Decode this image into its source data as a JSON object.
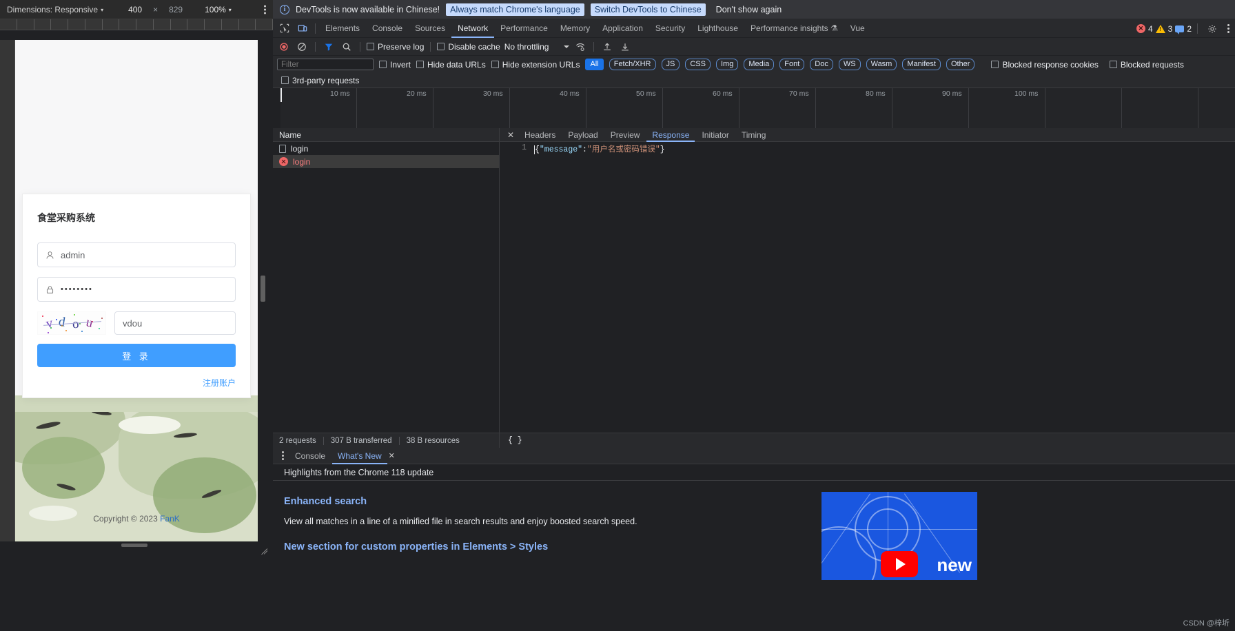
{
  "device_toolbar": {
    "dimensions_label": "Dimensions: Responsive",
    "caret": "▾",
    "width": "400",
    "times": "×",
    "height": "829",
    "zoom": "100%",
    "zoom_caret": "▾"
  },
  "login_page": {
    "title": "食堂采购系统",
    "username": {
      "icon": "user-icon",
      "value": "admin"
    },
    "password": {
      "icon": "lock-icon",
      "value": "••••••••"
    },
    "captcha": {
      "image_text": "vdou",
      "input_value": "vdou"
    },
    "submit_label": "登 录",
    "register_label": "注册账户",
    "copyright_prefix": "Copyright © 2023 ",
    "copyright_brand": "FanK"
  },
  "notification": {
    "icon": "info-icon",
    "message": "DevTools is now available in Chinese!",
    "primary_btn": "Always match Chrome's language",
    "secondary_btn": "Switch DevTools to Chinese",
    "dismiss_btn": "Don't show again"
  },
  "devtools_tabs": {
    "inspect_icon": "inspect-element-icon",
    "device_icon": "device-toolbar-icon",
    "items": [
      {
        "label": "Elements",
        "active": false
      },
      {
        "label": "Console",
        "active": false
      },
      {
        "label": "Sources",
        "active": false
      },
      {
        "label": "Network",
        "active": true
      },
      {
        "label": "Performance",
        "active": false
      },
      {
        "label": "Memory",
        "active": false
      },
      {
        "label": "Application",
        "active": false
      },
      {
        "label": "Security",
        "active": false
      },
      {
        "label": "Lighthouse",
        "active": false
      },
      {
        "label": "Performance insights ⚗",
        "active": false
      },
      {
        "label": "Vue",
        "active": false
      }
    ],
    "counters": {
      "errors": "4",
      "warnings": "3",
      "infos": "2"
    },
    "settings_icon": "gear-icon",
    "more_icon": "kebab-menu-icon"
  },
  "network_toolbar": {
    "record_icon": "record-stop-icon",
    "clear_icon": "clear-network-icon",
    "filter_icon": "filter-funnel-icon",
    "search_icon": "search-icon",
    "preserve_log": "Preserve log",
    "disable_cache": "Disable cache",
    "throttling": "No throttling",
    "throttle_caret": "▾",
    "wifi_icon": "network-conditions-icon",
    "import_icon": "import-har-icon",
    "export_icon": "export-har-icon"
  },
  "network_filter": {
    "filter_placeholder": "Filter",
    "filter_value": "",
    "invert": "Invert",
    "hide_data_urls": "Hide data URLs",
    "hide_extension_urls": "Hide extension URLs",
    "chips": [
      "All",
      "Fetch/XHR",
      "JS",
      "CSS",
      "Img",
      "Media",
      "Font",
      "Doc",
      "WS",
      "Wasm",
      "Manifest",
      "Other"
    ],
    "blocked_response_cookies": "Blocked response cookies",
    "blocked_requests": "Blocked requests",
    "third_party_requests": "3rd-party requests"
  },
  "overview": {
    "ticks": [
      "10 ms",
      "20 ms",
      "30 ms",
      "40 ms",
      "50 ms",
      "60 ms",
      "70 ms",
      "80 ms",
      "90 ms",
      "100 ms"
    ]
  },
  "request_list": {
    "header": "Name",
    "rows": [
      {
        "name": "login",
        "icon": "document-icon",
        "error": false,
        "selected": false
      },
      {
        "name": "login",
        "icon": "error-circle-icon",
        "error": true,
        "selected": true
      }
    ]
  },
  "detail_panel": {
    "close_icon": "close-icon",
    "tabs": [
      {
        "label": "Headers",
        "active": false
      },
      {
        "label": "Payload",
        "active": false
      },
      {
        "label": "Preview",
        "active": false
      },
      {
        "label": "Response",
        "active": true
      },
      {
        "label": "Initiator",
        "active": false
      },
      {
        "label": "Timing",
        "active": false
      }
    ],
    "line_number": "1",
    "response": {
      "open_brace": "{",
      "key": "\"message\"",
      "colon": ":",
      "value": "\"用户名或密码错误\"",
      "close_brace": "}"
    }
  },
  "status_bar": {
    "requests": "2 requests",
    "transferred": "307 B transferred",
    "resources": "38 B resources",
    "pretty_print": "{ }"
  },
  "drawer": {
    "more_icon": "kebab-menu-icon",
    "tabs": [
      {
        "label": "Console",
        "active": false,
        "closable": false
      },
      {
        "label": "What's New",
        "active": true,
        "closable": true
      }
    ],
    "close_icon": "close-icon",
    "subtitle": "Highlights from the Chrome 118 update",
    "sections": [
      {
        "heading": "Enhanced search",
        "body": "View all matches in a line of a minified file in search results and enjoy boosted search speed."
      },
      {
        "heading": "New section for custom properties in Elements > Styles",
        "body": ""
      }
    ],
    "thumbnail": {
      "icon": "youtube-play-icon",
      "caption": "new"
    }
  },
  "watermark": "CSDN @梓圻",
  "colors": {
    "accent_blue": "#8ab4f8",
    "chip_active": "#1a73e8",
    "login_button": "#409eff",
    "error_red": "#ff8080",
    "devtools_bg": "#202124",
    "toolbar_bg": "#292a2d"
  }
}
